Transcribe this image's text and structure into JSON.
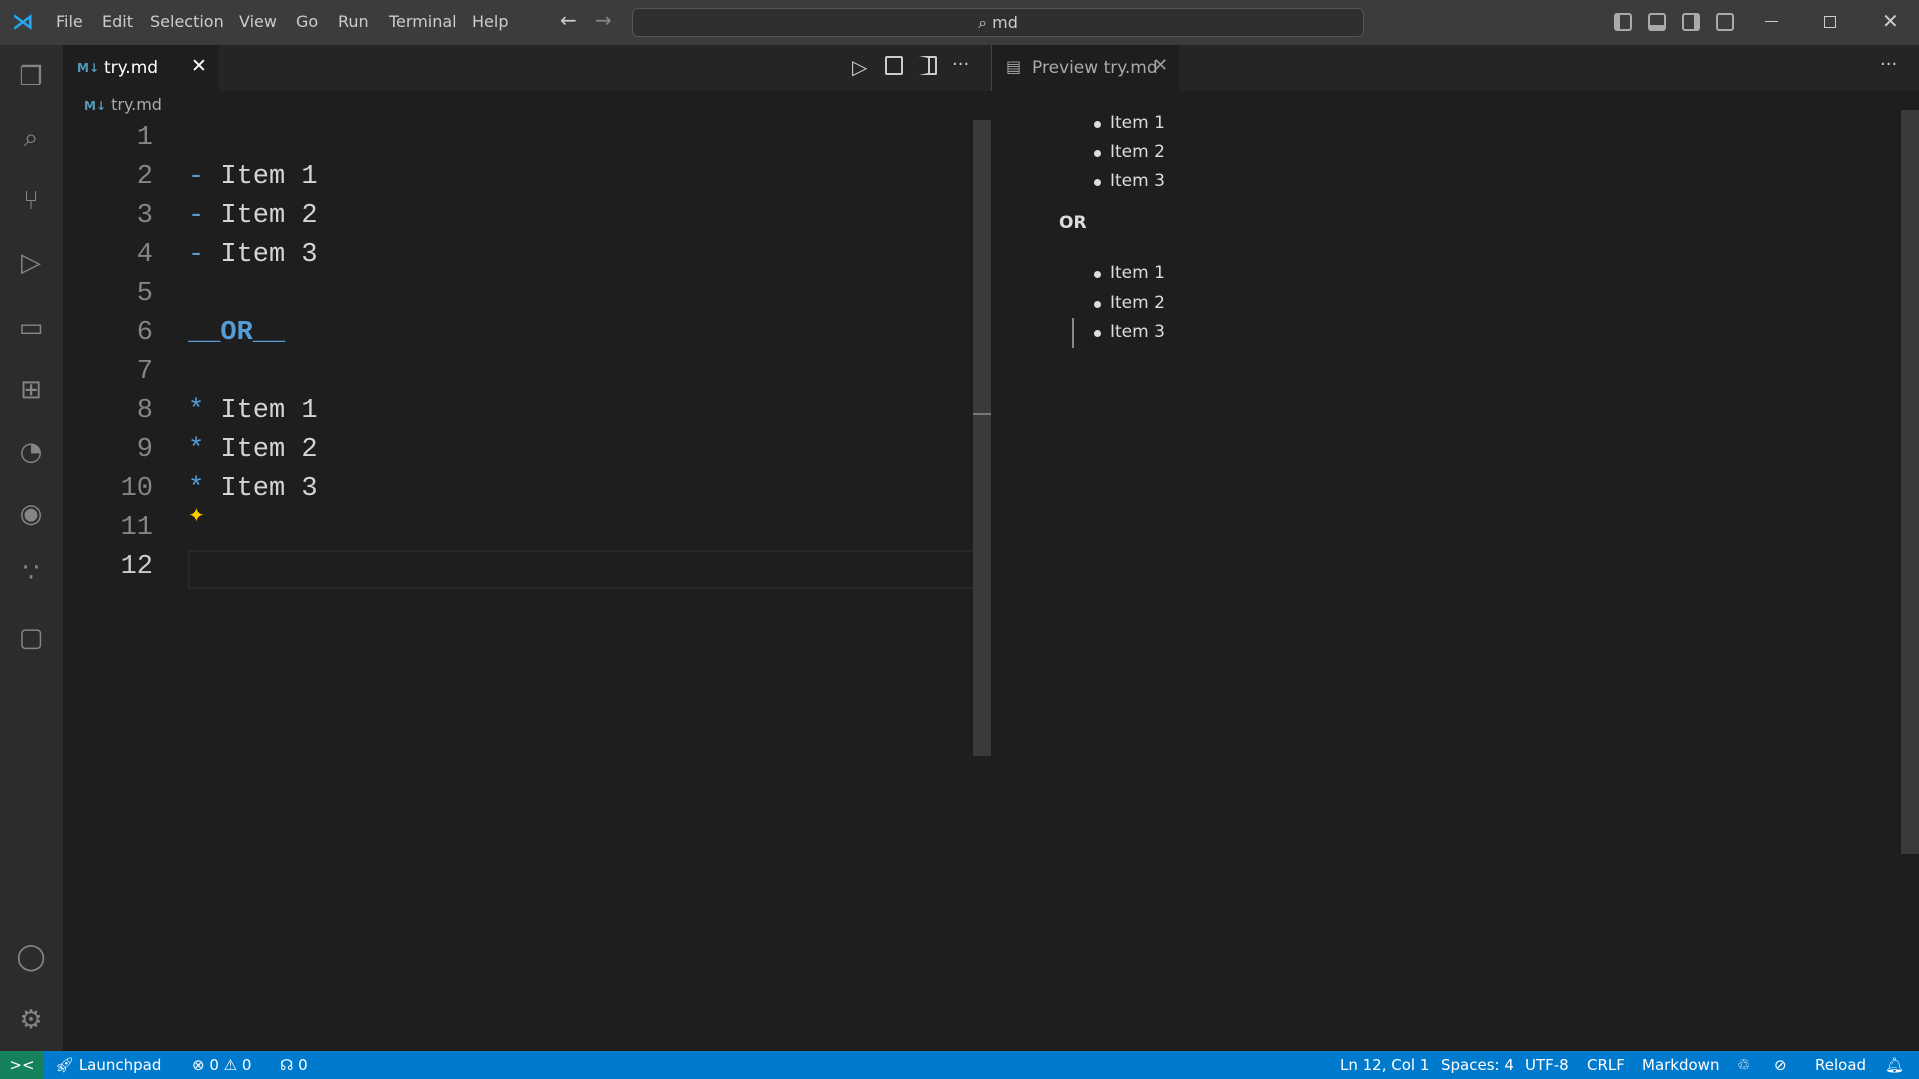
{
  "titlebar": {
    "menu": [
      "File",
      "Edit",
      "Selection",
      "View",
      "Go",
      "Run",
      "Terminal",
      "Help"
    ],
    "search": "md"
  },
  "editor": {
    "tab_label": "try.md",
    "tab_icon": "M↓",
    "breadcrumb": "try.md",
    "lines": [
      {
        "n": "1",
        "marker": "",
        "text": ""
      },
      {
        "n": "2",
        "marker": "-",
        "text": " Item 1"
      },
      {
        "n": "3",
        "marker": "-",
        "text": " Item 2"
      },
      {
        "n": "4",
        "marker": "-",
        "text": " Item 3"
      },
      {
        "n": "5",
        "marker": "",
        "text": ""
      },
      {
        "n": "6",
        "marker": "",
        "text": "__OR__"
      },
      {
        "n": "7",
        "marker": "",
        "text": ""
      },
      {
        "n": "8",
        "marker": "*",
        "text": " Item 1"
      },
      {
        "n": "9",
        "marker": "*",
        "text": " Item 2"
      },
      {
        "n": "10",
        "marker": "*",
        "text": " Item 3"
      },
      {
        "n": "11",
        "marker": "",
        "text": ""
      },
      {
        "n": "12",
        "marker": "",
        "text": ""
      }
    ]
  },
  "preview": {
    "tab_label": "Preview try.md",
    "list1": [
      "Item 1",
      "Item 2",
      "Item 3"
    ],
    "heading": "OR",
    "list2": [
      "Item 1",
      "Item 2",
      "Item 3"
    ]
  },
  "status": {
    "launchpad": "Launchpad",
    "errors": "0",
    "warnings": "0",
    "ports": "0",
    "position": "Ln 12, Col 1",
    "spaces": "Spaces: 4",
    "encoding": "UTF-8",
    "eol": "CRLF",
    "language": "Markdown",
    "reload": "Reload"
  },
  "colors": {
    "accent": "#007acc",
    "remote": "#16825d",
    "markdown_blue": "#569cd6"
  }
}
